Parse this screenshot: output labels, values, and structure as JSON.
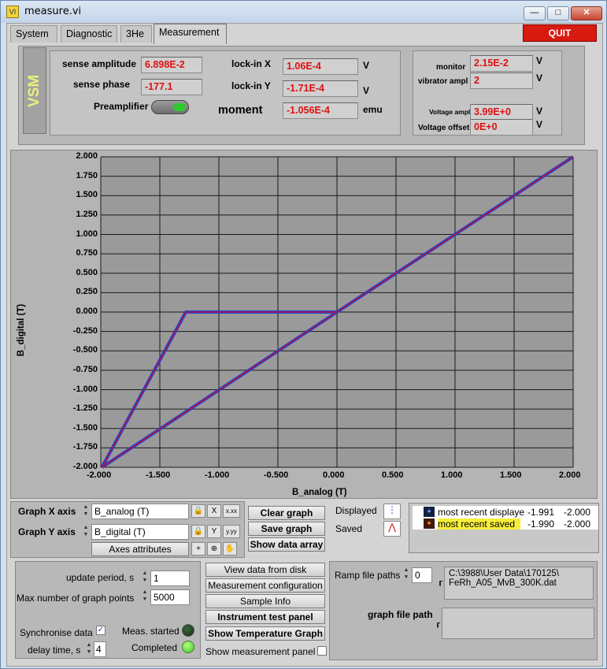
{
  "window": {
    "title": "measure.vi",
    "icon_text": "VI"
  },
  "tabs": [
    "System",
    "Diagnostic",
    "3He",
    "Measurement"
  ],
  "quit_label": "QUIT",
  "vsm_label": "VSM",
  "readouts": {
    "sense_amplitude": {
      "label": "sense amplitude",
      "value": "6.898E-2"
    },
    "sense_phase": {
      "label": "sense phase",
      "value": "-177.1"
    },
    "preamplifier": {
      "label": "Preamplifier",
      "on": true
    },
    "lockin_x": {
      "label": "lock-in X",
      "value": "1.06E-4",
      "unit": "V"
    },
    "lockin_y": {
      "label": "lock-in Y",
      "value": "-1.71E-4",
      "unit": "V"
    },
    "moment": {
      "label": "moment",
      "value": "-1.056E-4",
      "unit": "emu"
    },
    "monitor": {
      "label": "monitor",
      "value": "2.15E-2",
      "unit": "V"
    },
    "vibrator_ampl": {
      "label": "vibrator ampl",
      "value": "2",
      "unit": "V"
    },
    "voltage_ampl": {
      "label": "Voltage ampl",
      "value": "3.99E+0",
      "unit": "V"
    },
    "voltage_offset": {
      "label": "Voltage offset",
      "value": "0E+0",
      "unit": "V"
    }
  },
  "chart_data": {
    "type": "line",
    "xlabel": "B_analog (T)",
    "ylabel": "B_digital (T)",
    "xlim": [
      -2.0,
      2.0
    ],
    "ylim": [
      -2.0,
      2.0
    ],
    "x_ticks": [
      "-2.000",
      "-1.500",
      "-1.000",
      "-0.500",
      "0.000",
      "0.500",
      "1.000",
      "1.500",
      "2.000"
    ],
    "y_ticks": [
      "2.000",
      "1.750",
      "1.500",
      "1.250",
      "1.000",
      "0.750",
      "0.500",
      "0.250",
      "0.000",
      "-0.250",
      "-0.500",
      "-0.750",
      "-1.000",
      "-1.250",
      "-1.500",
      "-1.750",
      "-2.000"
    ],
    "grid": true,
    "series": [
      {
        "color": "#1f3fd8",
        "points": [
          [
            -1.99,
            -2.0
          ],
          [
            0.0,
            0.0
          ],
          [
            2.0,
            2.0
          ]
        ]
      },
      {
        "color": "#1f3fd8",
        "points": [
          [
            -1.99,
            -2.0
          ],
          [
            -1.28,
            0.0
          ],
          [
            0.0,
            0.0
          ]
        ]
      },
      {
        "color": "#d0101a",
        "points": [
          [
            -1.99,
            -2.0
          ],
          [
            0.0,
            0.0
          ],
          [
            2.0,
            2.0
          ]
        ]
      },
      {
        "color": "#d0101a",
        "points": [
          [
            -1.99,
            -2.0
          ],
          [
            -1.28,
            0.0
          ],
          [
            0.0,
            0.0
          ]
        ]
      }
    ]
  },
  "graph_controls": {
    "x_axis_label": "Graph X axis",
    "x_axis_value": "B_analog (T)",
    "y_axis_label": "Graph Y axis",
    "y_axis_value": "B_digital (T)",
    "axes_attributes": "Axes attributes",
    "clear_graph": "Clear graph",
    "save_graph": "Save graph",
    "show_data_array": "Show data array",
    "x_format_icon": "x.xx",
    "y_format_icon": "y.yy"
  },
  "plot_legend": {
    "displayed_label": "Displayed",
    "saved_label": "Saved",
    "rows": [
      {
        "name": "most recent displayed",
        "x": "-1.991",
        "y": "-2.000"
      },
      {
        "name": "most recent saved",
        "x": "-1.990",
        "y": "-2.000"
      }
    ]
  },
  "settings": {
    "update_period_label": "update period, s",
    "update_period_value": "1",
    "max_points_label": "Max number of graph points",
    "max_points_value": "5000",
    "sync_label": "Synchronise data",
    "sync_checked": true,
    "delay_label": "delay time, s",
    "delay_value": "4",
    "meas_started_label": "Meas. started",
    "completed_label": "Completed"
  },
  "actions": {
    "view_data": "View data from disk",
    "measurement_config": "Measurement configuration",
    "sample_info": "Sample Info",
    "instrument_test": "Instrument test panel",
    "show_temp_graph": "Show Temperature Graph",
    "show_meas_panel": "Show measurement panel"
  },
  "files": {
    "ramp_label": "Ramp file paths",
    "ramp_index": "0",
    "ramp_path_line1": "C:\\3988\\User Data\\170125\\",
    "ramp_path_line2": "FeRh_A05_MvB_300K.dat",
    "graph_path_label": "graph file path",
    "graph_path_value": ""
  },
  "colors": {
    "alarm_text": "#e01010",
    "quit_bg": "#d81a10",
    "led_on": "#2ec92e",
    "led_off": "#1f3a1f"
  }
}
